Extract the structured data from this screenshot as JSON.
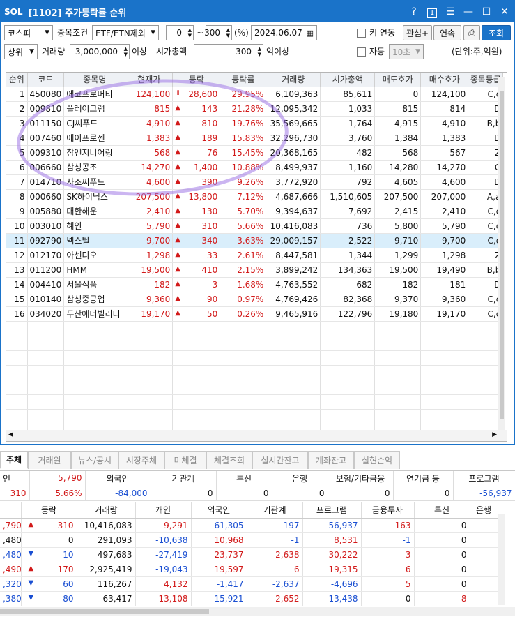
{
  "window": {
    "logo": "SOL",
    "title": "[1102] 주가등락률 순위",
    "icons": [
      "help-icon",
      "one-icon",
      "menu-icon",
      "minimize-icon",
      "maximize-icon",
      "close-icon"
    ]
  },
  "controls": {
    "market": "코스피",
    "cond_label": "종목조건",
    "cond": "ETF/ETN제외",
    "from": "0",
    "tilde": "~",
    "to": "300",
    "pct": "(%)",
    "date": "2024.06.07",
    "key_label": "키 연동",
    "interest": "관심+",
    "continuous": "연속",
    "query": "조회",
    "rank": "상위",
    "vol_label": "거래량",
    "vol": "3,000,000",
    "vol_suffix": "이상",
    "cap_label": "시가총액",
    "cap": "300",
    "cap_suffix": "억이상",
    "auto_label": "자동",
    "interval": "10초",
    "unit": "(단위:주,억원)"
  },
  "grid": {
    "headers": [
      "순위",
      "코드",
      "종목명",
      "현재가",
      "등락",
      "등락률",
      "거래량",
      "시가총액",
      "매도호가",
      "매수호가",
      "종목등급"
    ],
    "rows": [
      [
        "1",
        "450080",
        "에코프로머티",
        "124,100",
        "up",
        "28,600",
        "29.95%",
        "6,109,363",
        "85,611",
        "0",
        "124,100",
        "C,c"
      ],
      [
        "2",
        "009810",
        "플레이그램",
        "815",
        "tri",
        "143",
        "21.28%",
        "12,095,342",
        "1,033",
        "815",
        "814",
        "D"
      ],
      [
        "3",
        "011150",
        "CJ씨푸드",
        "4,910",
        "tri",
        "810",
        "19.76%",
        "35,569,665",
        "1,764",
        "4,915",
        "4,910",
        "B,b"
      ],
      [
        "4",
        "007460",
        "에이프로젠",
        "1,383",
        "tri",
        "189",
        "15.83%",
        "32,296,730",
        "3,760",
        "1,384",
        "1,383",
        "D"
      ],
      [
        "5",
        "009310",
        "참엔지니어링",
        "568",
        "tri",
        "76",
        "15.45%",
        "20,368,165",
        "482",
        "568",
        "567",
        "Z"
      ],
      [
        "6",
        "006660",
        "삼성공조",
        "14,270",
        "tri",
        "1,400",
        "10.88%",
        "8,499,937",
        "1,160",
        "14,280",
        "14,270",
        "C"
      ],
      [
        "7",
        "014710",
        "사조씨푸드",
        "4,600",
        "tri",
        "390",
        "9.26%",
        "3,772,920",
        "792",
        "4,605",
        "4,600",
        "D"
      ],
      [
        "8",
        "000660",
        "SK하이닉스",
        "207,500",
        "tri",
        "13,800",
        "7.12%",
        "4,687,666",
        "1,510,605",
        "207,500",
        "207,000",
        "A,a"
      ],
      [
        "9",
        "005880",
        "대한해운",
        "2,410",
        "tri",
        "130",
        "5.70%",
        "9,394,637",
        "7,692",
        "2,415",
        "2,410",
        "C,c"
      ],
      [
        "10",
        "003010",
        "혜인",
        "5,790",
        "tri",
        "310",
        "5.66%",
        "10,416,083",
        "736",
        "5,800",
        "5,790",
        "C,c"
      ],
      [
        "11",
        "092790",
        "넥스틸",
        "9,700",
        "tri",
        "340",
        "3.63%",
        "29,009,157",
        "2,522",
        "9,710",
        "9,700",
        "C,c"
      ],
      [
        "12",
        "012170",
        "아센디오",
        "1,298",
        "tri",
        "33",
        "2.61%",
        "8,447,581",
        "1,344",
        "1,299",
        "1,298",
        "Z"
      ],
      [
        "13",
        "011200",
        "HMM",
        "19,500",
        "tri",
        "410",
        "2.15%",
        "3,899,242",
        "134,363",
        "19,500",
        "19,490",
        "B,b"
      ],
      [
        "14",
        "004410",
        "서울식품",
        "182",
        "tri",
        "3",
        "1.68%",
        "4,763,552",
        "682",
        "182",
        "181",
        "D"
      ],
      [
        "15",
        "010140",
        "삼성중공업",
        "9,360",
        "tri",
        "90",
        "0.97%",
        "4,769,426",
        "82,368",
        "9,370",
        "9,360",
        "C,c"
      ],
      [
        "16",
        "034020",
        "두산에너빌리티",
        "19,170",
        "tri",
        "50",
        "0.26%",
        "9,465,916",
        "122,796",
        "19,180",
        "19,170",
        "C,c"
      ]
    ]
  },
  "tabs": [
    "주체",
    "거래원",
    "뉴스/공시",
    "시장주체",
    "미체결",
    "체결조회",
    "실시간잔고",
    "계좌잔고",
    "실현손익"
  ],
  "investor": {
    "headers": [
      "인",
      "",
      "외국인",
      "기관계",
      "투신",
      "은행",
      "보험/기타금융",
      "연기금 등",
      "프로그램"
    ],
    "values": [
      "310",
      "5.66%",
      "-84,000",
      "0",
      "0",
      "0",
      "0",
      "0",
      "-56,937"
    ],
    "price": "5,790"
  },
  "detail": {
    "headers": [
      "",
      "등락",
      "거래량",
      "개인",
      "외국인",
      "기관계",
      "프로그램",
      "금융투자",
      "투신",
      "은행"
    ],
    "rows": [
      [
        ",790",
        "up",
        "310",
        "10,416,083",
        "9,291",
        "-61,305",
        "-197",
        "-56,937",
        "163",
        "0",
        ""
      ],
      [
        ",480",
        "",
        "0",
        "291,093",
        "-10,638",
        "10,968",
        "-1",
        "8,531",
        "-1",
        "0",
        ""
      ],
      [
        ",480",
        "down",
        "10",
        "497,683",
        "-27,419",
        "23,737",
        "2,638",
        "30,222",
        "3",
        "0",
        ""
      ],
      [
        ",490",
        "up",
        "170",
        "2,925,419",
        "-19,043",
        "19,597",
        "6",
        "19,315",
        "6",
        "0",
        ""
      ],
      [
        ",320",
        "down",
        "60",
        "116,267",
        "4,132",
        "-1,417",
        "-2,637",
        "-4,696",
        "5",
        "0",
        ""
      ],
      [
        ",380",
        "down",
        "80",
        "63,417",
        "13,108",
        "-15,921",
        "2,652",
        "-13,438",
        "0",
        "8",
        ""
      ]
    ]
  }
}
